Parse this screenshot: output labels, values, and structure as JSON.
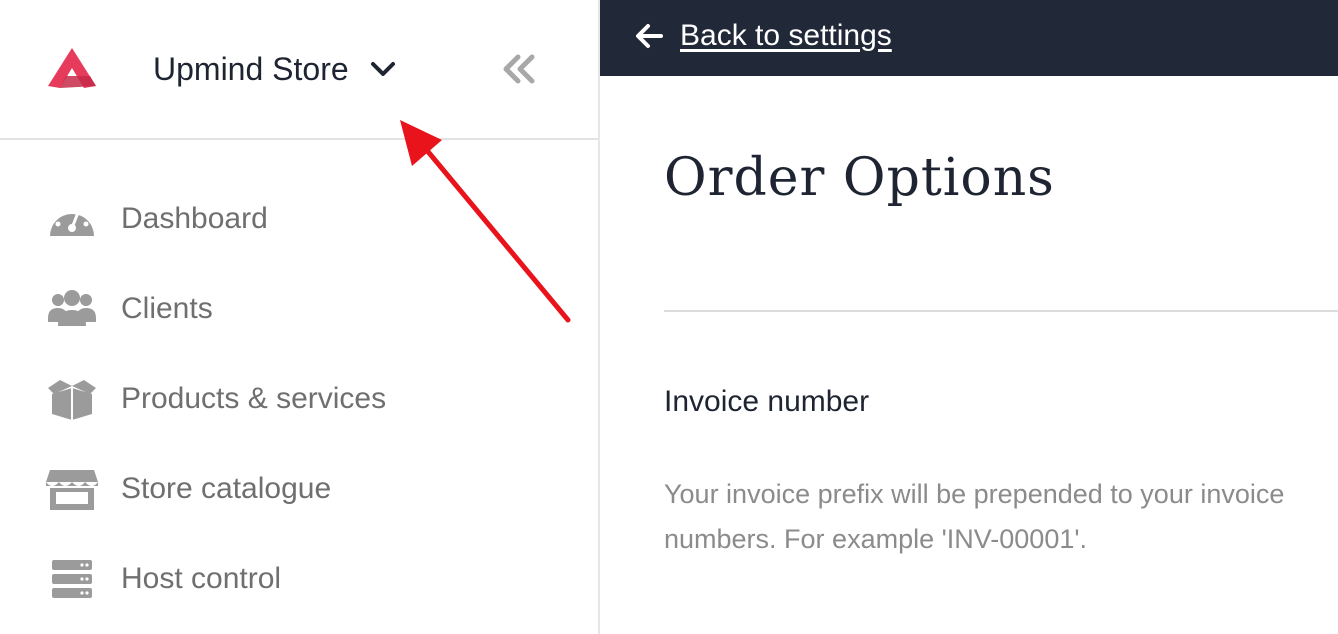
{
  "sidebar": {
    "store_name": "Upmind Store",
    "items": [
      {
        "label": "Dashboard",
        "icon": "dashboard-gauge-icon"
      },
      {
        "label": "Clients",
        "icon": "users-icon"
      },
      {
        "label": "Products & services",
        "icon": "box-icon"
      },
      {
        "label": "Store catalogue",
        "icon": "storefront-icon"
      },
      {
        "label": "Host control",
        "icon": "server-icon"
      }
    ]
  },
  "topbar": {
    "back_label": "Back to settings"
  },
  "main": {
    "title": "Order Options",
    "section_title": "Invoice number",
    "help_text": "Your invoice prefix will be prepended to your invoice numbers. For example 'INV-00001'."
  },
  "colors": {
    "brand": "#e63b5a",
    "topbar_bg": "#212837",
    "annotation_arrow": "#e8131b",
    "nav_text": "#6f6f6f",
    "nav_icon": "#9b9b9b"
  }
}
